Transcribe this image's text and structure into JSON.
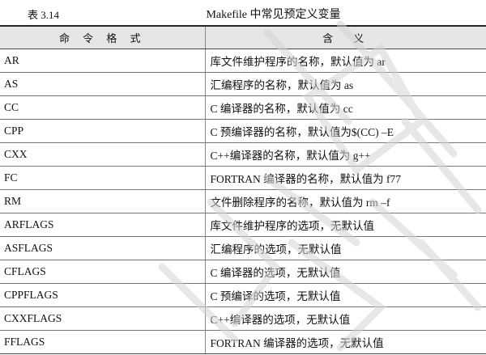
{
  "caption": {
    "number": "表 3.14",
    "title": "Makefile 中常见预定义变量"
  },
  "table": {
    "headers": [
      "命 令 格 式",
      "含　义"
    ],
    "rows": [
      [
        "AR",
        "库文件维护程序的名称，默认值为 ar"
      ],
      [
        "AS",
        "汇编程序的名称，默认值为 as"
      ],
      [
        "CC",
        "C 编译器的名称，默认值为 cc"
      ],
      [
        "CPP",
        "C 预编译器的名称，默认值为$(CC) –E"
      ],
      [
        "CXX",
        "C++编译器的名称，默认值为 g++"
      ],
      [
        "FC",
        "FORTRAN 编译器的名称，默认值为 f77"
      ],
      [
        "RM",
        "文件删除程序的名称，默认值为 rm –f"
      ],
      [
        "ARFLAGS",
        "库文件维护程序的选项，无默认值"
      ],
      [
        "ASFLAGS",
        "汇编程序的选项，无默认值"
      ],
      [
        "CFLAGS",
        "C 编译器的选项，无默认值"
      ],
      [
        "CPPFLAGS",
        "C 预编译的选项，无默认值"
      ],
      [
        "CXXFLAGS",
        "C++编译器的选项，无默认值"
      ],
      [
        "FFLAGS",
        "FORTRAN 编译器的选项，无默认值"
      ]
    ]
  },
  "colors": {
    "header_background": "#e6e6e6",
    "rule": "#222222",
    "watermark": "#d4d4d4"
  }
}
